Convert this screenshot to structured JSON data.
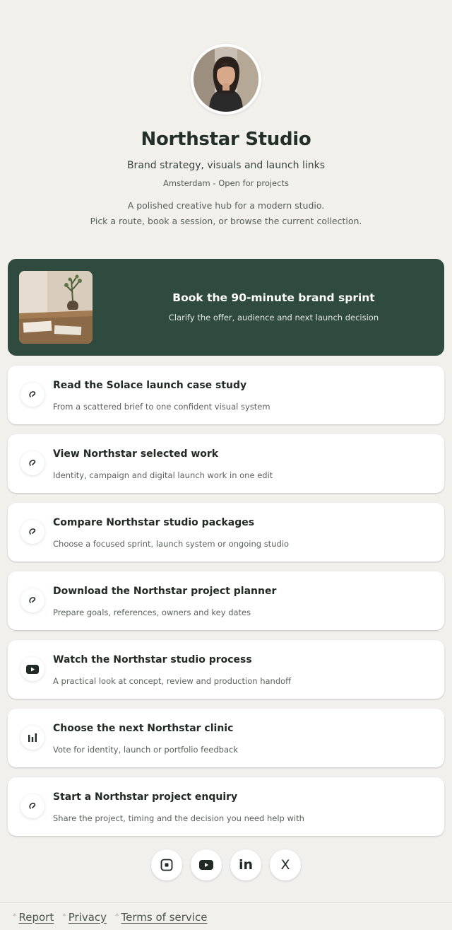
{
  "profile": {
    "name": "Northstar Studio",
    "tagline": "Brand strategy, visuals and launch links",
    "location": "Amsterdam - Open for projects",
    "bio_line1": "A polished creative hub for a modern studio.",
    "bio_line2": "Pick a route, book a session, or browse the current collection."
  },
  "featured": {
    "title": "Book the 90-minute brand sprint",
    "subtitle": "Clarify the offer, audience and next launch decision",
    "background": "#2f4a3e"
  },
  "links": [
    {
      "icon": "link-icon",
      "title": "Read the Solace launch case study",
      "subtitle": "From a scattered brief to one confident visual system"
    },
    {
      "icon": "link-icon",
      "title": "View Northstar selected work",
      "subtitle": "Identity, campaign and digital launch work in one edit"
    },
    {
      "icon": "link-icon",
      "title": "Compare Northstar studio packages",
      "subtitle": "Choose a focused sprint, launch system or ongoing studio"
    },
    {
      "icon": "link-icon",
      "title": "Download the Northstar project planner",
      "subtitle": "Prepare goals, references, owners and key dates"
    },
    {
      "icon": "youtube-icon",
      "title": "Watch the Northstar studio process",
      "subtitle": "A practical look at concept, review and production handoff"
    },
    {
      "icon": "bar-chart-icon",
      "title": "Choose the next Northstar clinic",
      "subtitle": "Vote for identity, launch or portfolio feedback"
    },
    {
      "icon": "link-icon",
      "title": "Start a Northstar project enquiry",
      "subtitle": "Share the project, timing and the decision you need help with"
    }
  ],
  "social": [
    "instagram-icon",
    "youtube-icon",
    "linkedin-icon",
    "x-icon"
  ],
  "social_labels": {
    "linkedin": "in",
    "x": "X"
  },
  "footer": {
    "report": "Report",
    "privacy": "Privacy",
    "terms": "Terms of service",
    "marker": "*"
  },
  "colors": {
    "background": "#f1f0ed",
    "accent": "#2f4a3e",
    "card": "#ffffff"
  }
}
